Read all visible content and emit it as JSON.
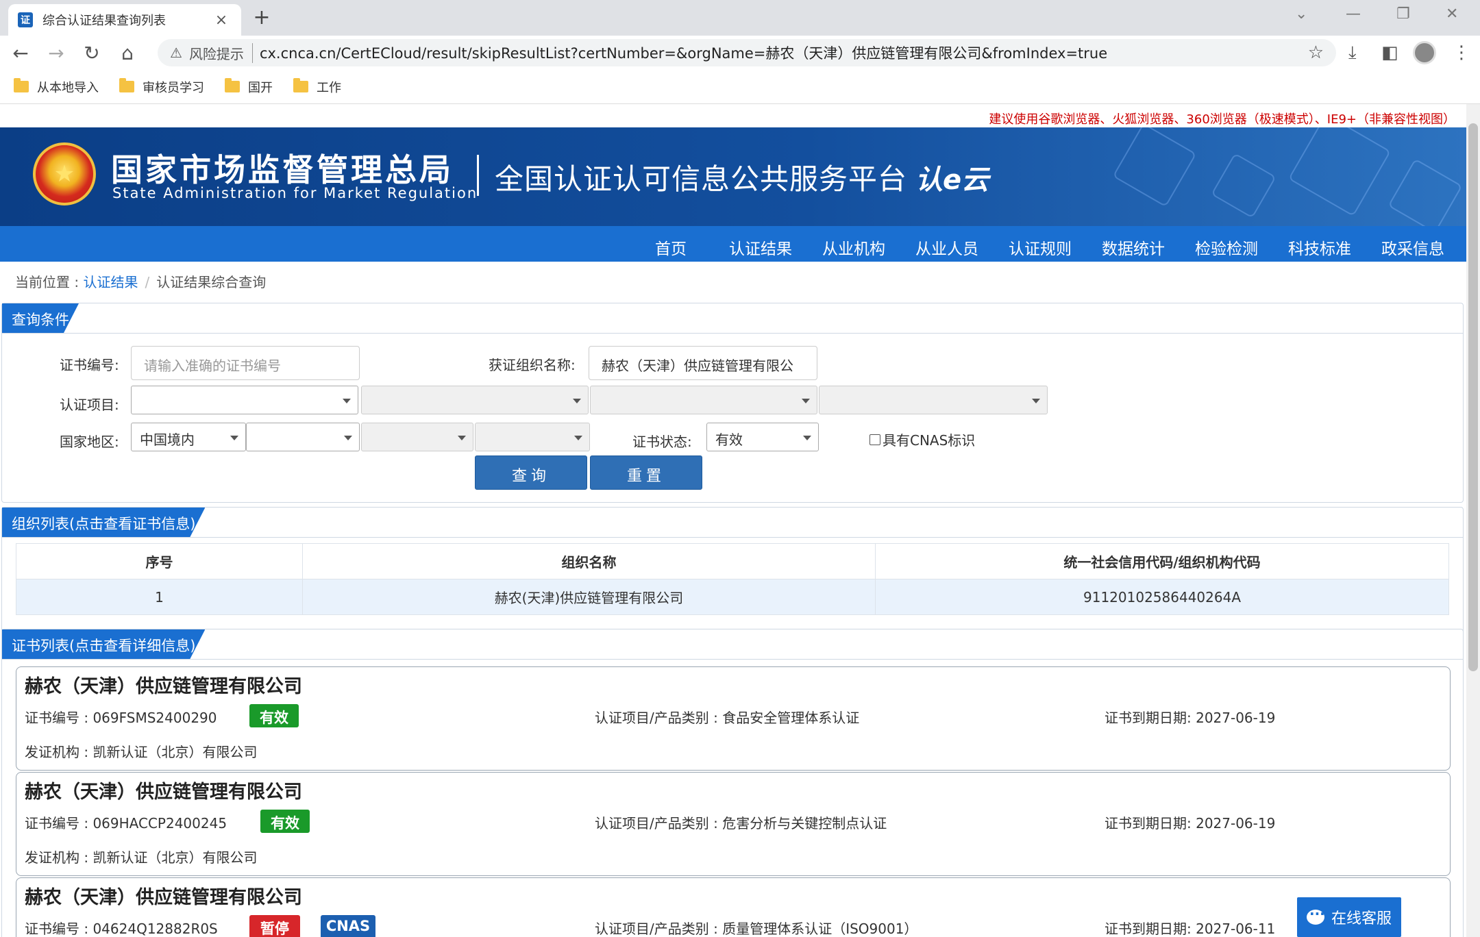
{
  "browser": {
    "tab_title": "综合认证结果查询列表",
    "tab_favicon": "证",
    "risk_label": "风险提示",
    "url": "cx.cnca.cn/CertECloud/result/skipResultList?certNumber=&orgName=赫农（天津）供应链管理有限公司&fromIndex=true",
    "bookmarks": [
      "从本地导入",
      "审核员学习",
      "国开",
      "工作"
    ]
  },
  "site": {
    "tip": "建议使用谷歌浏览器、火狐浏览器、360浏览器（极速模式）、IE9+（非兼容性视图）",
    "org_cn": "国家市场监督管理总局",
    "org_en": "State Administration  for  Market Regulation",
    "platform": "全国认证认可信息公共服务平台",
    "logo_mark": "认e云",
    "nav": [
      "首页",
      "认证结果",
      "从业机构",
      "从业人员",
      "认证规则",
      "数据统计",
      "检验检测",
      "科技标准",
      "政采信息"
    ]
  },
  "breadcrumb": {
    "prefix": "当前位置 : ",
    "link": "认证结果",
    "current": "认证结果综合查询"
  },
  "query": {
    "panel_title": "查询条件",
    "cert_no_label": "证书编号:",
    "cert_no_placeholder": "请输入准确的证书编号",
    "org_label": "获证组织名称:",
    "org_value": "赫农（天津）供应链管理有限公",
    "project_label": "认证项目:",
    "region_label": "国家地区:",
    "region_value": "中国境内",
    "status_label": "证书状态:",
    "status_value": "有效",
    "cnas_label": "具有CNAS标识",
    "search_btn": "查询",
    "reset_btn": "重置"
  },
  "org_list": {
    "panel_title": "组织列表(点击查看证书信息)",
    "headers": [
      "序号",
      "组织名称",
      "统一社会信用代码/组织机构代码"
    ],
    "rows": [
      [
        "1",
        "赫农(天津)供应链管理有限公司",
        "91120102586440264A"
      ]
    ]
  },
  "cert_list": {
    "panel_title": "证书列表(点击查看详细信息)",
    "items": [
      {
        "title": "赫农（天津）供应链管理有限公司",
        "number": "证书编号 : 069FSMS2400290",
        "status": "有效",
        "project": "认证项目/产品类别 : 食品安全管理体系认证",
        "expire": "证书到期日期: 2027-06-19",
        "issuer": "发证机构 : 凯新认证（北京）有限公司"
      },
      {
        "title": "赫农（天津）供应链管理有限公司",
        "number": "证书编号 : 069HACCP2400245",
        "status": "有效",
        "project": "认证项目/产品类别 : 危害分析与关键控制点认证",
        "expire": "证书到期日期: 2027-06-19",
        "issuer": "发证机构 : 凯新认证（北京）有限公司"
      },
      {
        "title": "赫农（天津）供应链管理有限公司",
        "number": "证书编号 : 04624Q12882R0S",
        "status": "暂停",
        "cnas": "CNAS",
        "project": "认证项目/产品类别 : 质量管理体系认证（ISO9001）",
        "expire": "证书到期日期: 2027-06-11"
      }
    ]
  },
  "service_label": "在线客服",
  "colors": {
    "primary": "#1a6fd1",
    "valid": "#1a9a2a",
    "suspended": "#d7262a",
    "cnas": "#1c5fb0"
  }
}
